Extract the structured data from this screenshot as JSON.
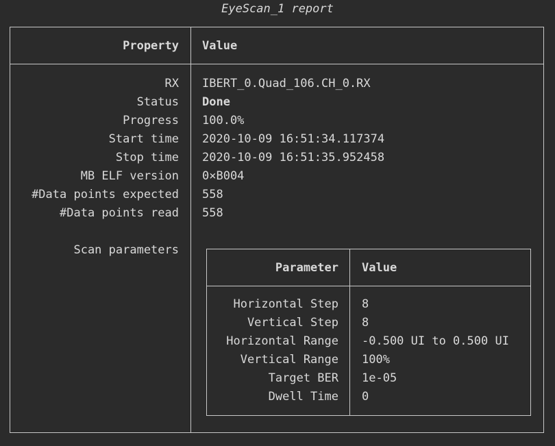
{
  "title": "EyeScan_1 report",
  "table": {
    "header": {
      "property": "Property",
      "value": "Value"
    },
    "rows": [
      {
        "property": "RX",
        "value": "IBERT_0.Quad_106.CH_0.RX"
      },
      {
        "property": "Status",
        "value": "Done"
      },
      {
        "property": "Progress",
        "value": "100.0%"
      },
      {
        "property": "Start time",
        "value": "2020-10-09 16:51:34.117374"
      },
      {
        "property": "Stop time",
        "value": "2020-10-09 16:51:35.952458"
      },
      {
        "property": "MB ELF version",
        "value": "0×B004"
      },
      {
        "property": "#Data points expected",
        "value": "558"
      },
      {
        "property": "#Data points read",
        "value": "558"
      }
    ],
    "scan_parameters_label": "Scan parameters"
  },
  "scan_parameters": {
    "header": {
      "parameter": "Parameter",
      "value": "Value"
    },
    "rows": [
      {
        "parameter": "Horizontal Step",
        "value": "8"
      },
      {
        "parameter": "Vertical Step",
        "value": "8"
      },
      {
        "parameter": "Horizontal Range",
        "value": "-0.500 UI to 0.500 UI"
      },
      {
        "parameter": "Vertical Range",
        "value": "100%"
      },
      {
        "parameter": "Target BER",
        "value": "1e-05"
      },
      {
        "parameter": "Dwell Time",
        "value": "0"
      }
    ]
  }
}
